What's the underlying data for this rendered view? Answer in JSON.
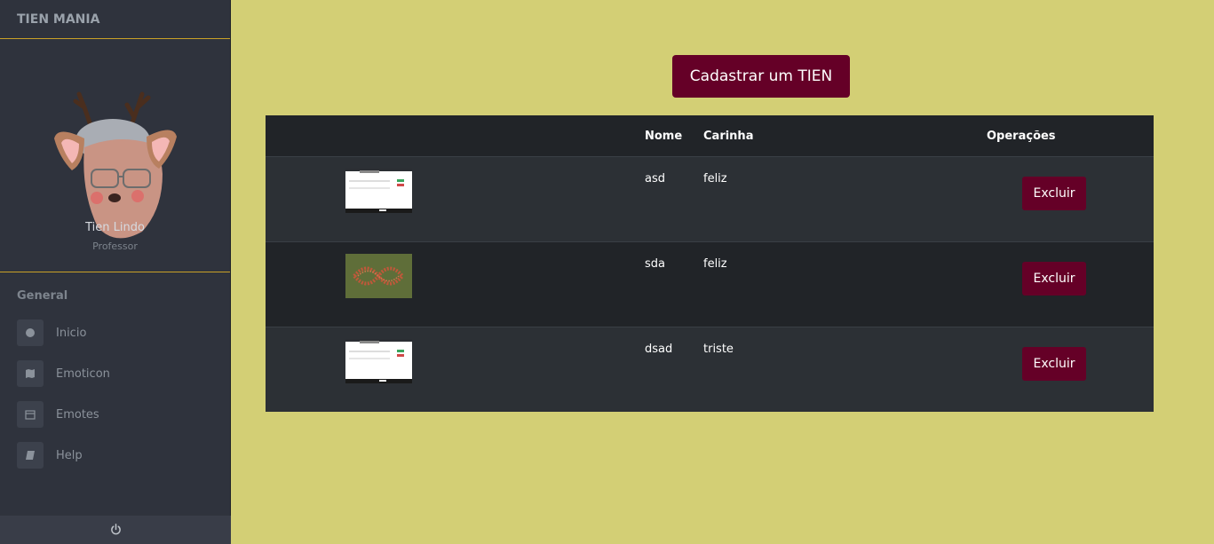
{
  "app": {
    "brand": "TIEN MANIA"
  },
  "profile": {
    "name": "Tien Lindo",
    "role": "Professor"
  },
  "sidebar": {
    "section_title": "General",
    "items": [
      {
        "label": "Inicio",
        "icon": "circle-icon"
      },
      {
        "label": "Emoticon",
        "icon": "map-icon"
      },
      {
        "label": "Emotes",
        "icon": "calendar-icon"
      },
      {
        "label": "Help",
        "icon": "book-icon"
      }
    ],
    "footer_icon": "power-icon"
  },
  "main": {
    "add_button": "Cadastrar um TIEN",
    "table": {
      "headers": {
        "image": "",
        "name": "Nome",
        "carinha": "Carinha",
        "ops": "Operações"
      },
      "rows": [
        {
          "thumb": "screenshot-thumbnail",
          "name": "asd",
          "carinha": "feliz",
          "action": "Excluir"
        },
        {
          "thumb": "pattern-thumbnail",
          "name": "sda",
          "carinha": "feliz",
          "action": "Excluir"
        },
        {
          "thumb": "screenshot-thumbnail",
          "name": "dsad",
          "carinha": "triste",
          "action": "Excluir"
        }
      ]
    }
  },
  "colors": {
    "page_bg": "#d3cf75",
    "sidebar_bg": "#2f333d",
    "accent_line": "#c9a227",
    "button_bg": "#650027",
    "table_dark": "#212428",
    "table_light": "#2c3035"
  }
}
